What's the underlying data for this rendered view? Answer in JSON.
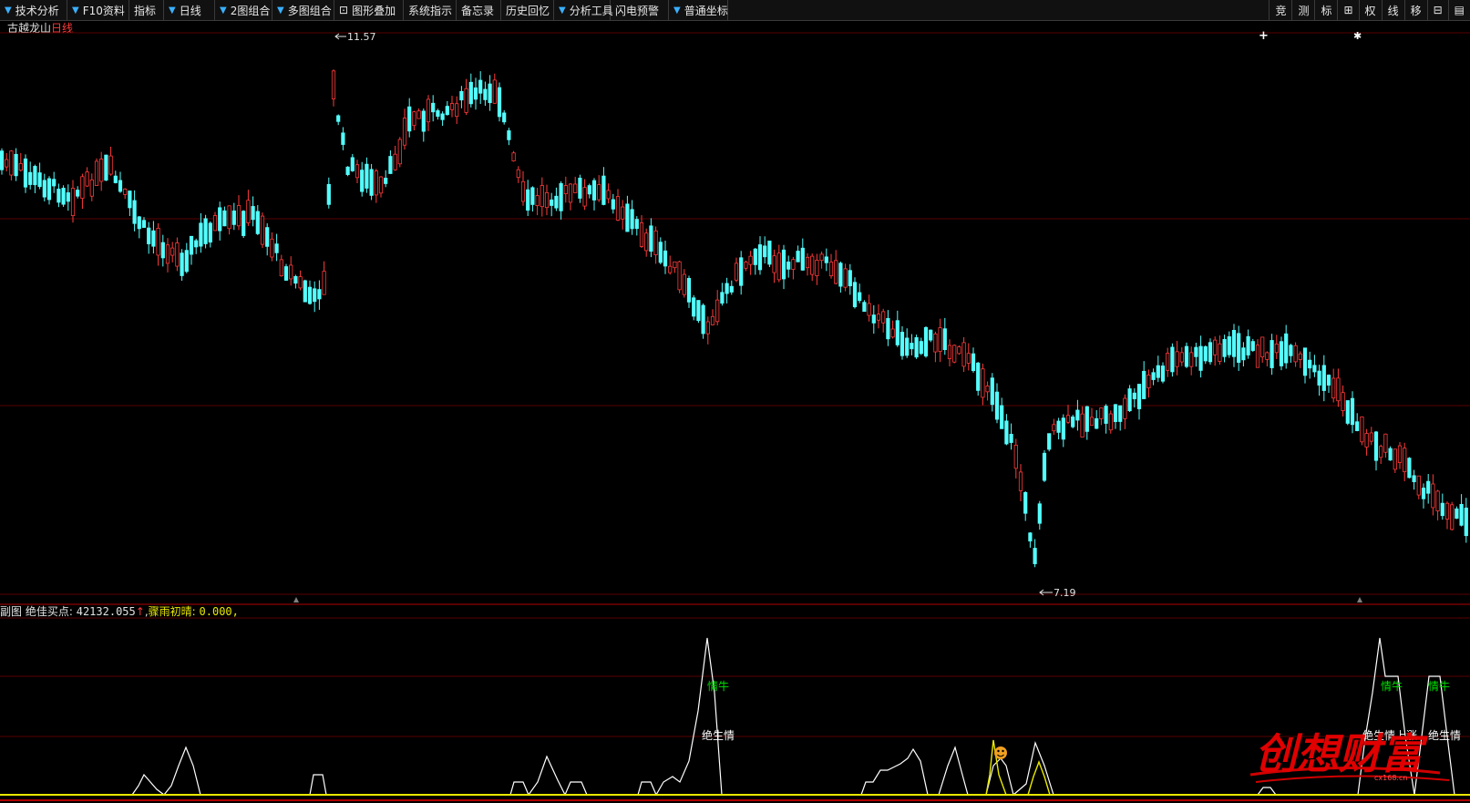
{
  "toolbar": {
    "items": [
      {
        "label": "技术分析",
        "arrow": true
      },
      {
        "label": "F10资料",
        "arrow": true
      },
      {
        "label": "指标",
        "arrow": false
      },
      {
        "label": "日线",
        "arrow": true
      },
      {
        "label": "2图组合",
        "arrow": true
      },
      {
        "label": "多图组合",
        "arrow": true
      },
      {
        "label": "图形叠加",
        "arrow": false,
        "lock": true
      },
      {
        "label": "系统指示",
        "arrow": false
      },
      {
        "label": "备忘录",
        "arrow": false
      },
      {
        "label": "历史回忆",
        "arrow": false
      },
      {
        "label": "分析工具",
        "arrow": true
      },
      {
        "label": "闪电预警",
        "arrow": false
      },
      {
        "label": "普通坐标",
        "arrow": true
      }
    ],
    "right_items": [
      "竞",
      "测",
      "标",
      "⊞",
      "权",
      "线",
      "移",
      "⊟",
      "▤"
    ]
  },
  "stock": {
    "name": "古越龙山",
    "period": "日线"
  },
  "main_chart": {
    "price_high_label": "11.57",
    "price_low_label": "7.19",
    "marker_plus": "+",
    "marker_star": "✱"
  },
  "indicator": {
    "panel_label": "副图",
    "name1": "绝佳买点:",
    "value1": "42132.055",
    "arrow1": "↑",
    "name2": "骤雨初晴:",
    "value2": "0.000,",
    "signal_labels": [
      {
        "text": "情牛",
        "color": "#00e000"
      },
      {
        "text": "绝生情",
        "color": "#ffffff"
      },
      {
        "text": "情牛",
        "color": "#00e000"
      },
      {
        "text": "情牛",
        "color": "#00e000"
      },
      {
        "text": "绝生情上涨",
        "color": "#ffffff"
      },
      {
        "text": "绝生情",
        "color": "#ffffff"
      }
    ],
    "smiley": "☻"
  },
  "watermark": {
    "text": "创想财富",
    "sub": "cx168.cn"
  },
  "colors": {
    "up": "#ff3b3b",
    "down": "#54ffff",
    "grid": "#5a0000",
    "yellow": "#e8e800",
    "white": "#ffffff"
  }
}
